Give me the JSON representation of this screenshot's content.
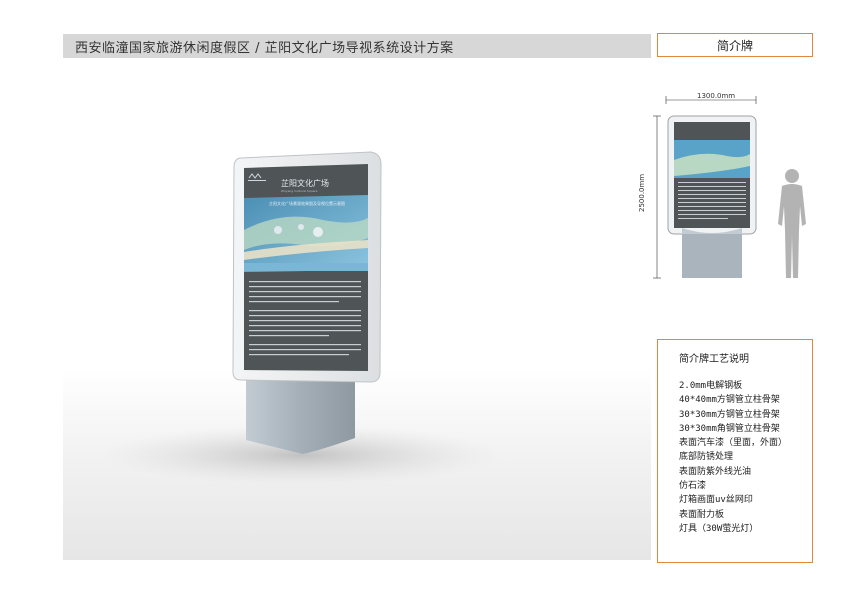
{
  "header": {
    "title": "西安临潼国家旅游休闲度假区 / 芷阳文化广场导视系统设计方案",
    "sign_type": "简介牌"
  },
  "sign": {
    "title": "芷阳文化广场",
    "subtitle": "Zhiyang Cultural Square",
    "map_caption": "芷阳文化广场景观效果图及导视位置示意图"
  },
  "elevation": {
    "width_dim": "1300.0mm",
    "height_dim": "2500.0mm"
  },
  "spec": {
    "title": "简介牌工艺说明",
    "items": [
      "2.0mm电解钢板",
      "40*40mm方钢管立柱骨架",
      "30*30mm方钢管立柱骨架",
      "30*30mm角钢管立柱骨架",
      "表面汽车漆（里面，外面）",
      "底部防锈处理",
      "表面防紫外线光油",
      "仿石漆",
      "灯箱画面uv丝网印",
      "表面耐力板",
      "灯具（30W萤光灯）"
    ]
  },
  "colors": {
    "accent": "#e0873c",
    "panel": "#4f5456",
    "map_water": "#5aa3c8",
    "stone": "#a9b4bd"
  }
}
